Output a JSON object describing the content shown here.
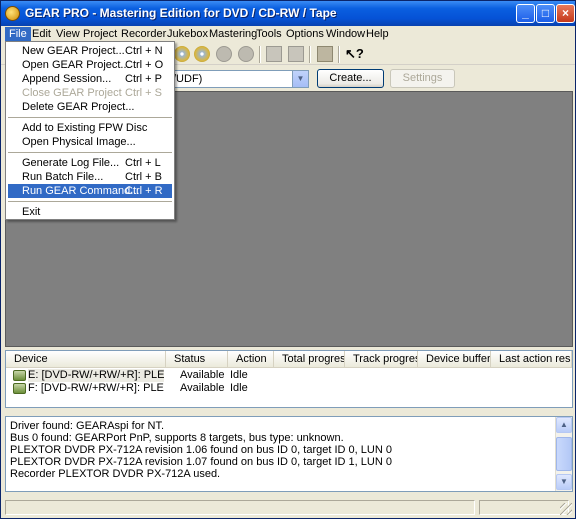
{
  "window": {
    "title": "GEAR PRO - Mastering Edition for DVD / CD-RW / Tape",
    "minimize": "_",
    "maximize": "□",
    "close": "×"
  },
  "menubar": {
    "items": [
      "File",
      "Edit",
      "View",
      "Project",
      "Recorder",
      "Jukebox",
      "Mastering",
      "Tools",
      "Options",
      "Window",
      "Help"
    ],
    "active": "File"
  },
  "toolbar": {
    "icons": [
      "disc-icon",
      "disc-icon",
      "gray-disc-icon",
      "gray-disc-icon",
      "gray-box-icon",
      "gray-box-icon",
      "folder-icon",
      "help-pointer-icon"
    ],
    "help_glyph": "?"
  },
  "project_bar": {
    "format_value": "/UDF)",
    "create_label": "Create...",
    "settings_label": "Settings"
  },
  "device_table": {
    "columns": [
      "Device",
      "Status",
      "Action",
      "Total progress",
      "Track progress",
      "Device buffer",
      "Last action result"
    ],
    "rows": [
      {
        "device": "E: [DVD-RW/+RW/+R]:  PLEX...",
        "status": "Available",
        "action": "Idle"
      },
      {
        "device": "F: [DVD-RW/+RW/+R]:  PLEXT...",
        "status": "Available",
        "action": "Idle"
      }
    ]
  },
  "log": {
    "lines": [
      "Driver found: GEARAspi for NT.",
      "Bus 0 found: GEARPort PnP, supports 8 targets, bus type: unknown.",
      "PLEXTOR  DVDR   PX-712A   revision 1.06 found on bus ID 0, target ID 0, LUN 0",
      "PLEXTOR  DVDR   PX-712A   revision 1.07 found on bus ID 0, target ID 1, LUN 0",
      "Recorder PLEXTOR DVDR   PX-712A used."
    ]
  },
  "file_menu": {
    "items": [
      {
        "label": "New GEAR Project...",
        "shortcut": "Ctrl + N",
        "disabled": false
      },
      {
        "label": "Open GEAR Project...",
        "shortcut": "Ctrl + O",
        "disabled": false
      },
      {
        "label": "Append Session...",
        "shortcut": "Ctrl + P",
        "disabled": false
      },
      {
        "label": "Close GEAR Project",
        "shortcut": "Ctrl + S",
        "disabled": true
      },
      {
        "label": "Delete GEAR Project...",
        "shortcut": "",
        "disabled": false
      },
      {
        "label": "Add to Existing FPW Disc",
        "shortcut": "",
        "disabled": false
      },
      {
        "label": "Open Physical Image...",
        "shortcut": "",
        "disabled": false
      },
      {
        "label": "Generate Log File...",
        "shortcut": "Ctrl + L",
        "disabled": false
      },
      {
        "label": "Run Batch File...",
        "shortcut": "Ctrl + B",
        "disabled": false
      },
      {
        "label": "Run GEAR Command...",
        "shortcut": "Ctrl + R",
        "disabled": false,
        "highlighted": true
      },
      {
        "label": "Exit",
        "shortcut": "",
        "disabled": false
      }
    ]
  }
}
